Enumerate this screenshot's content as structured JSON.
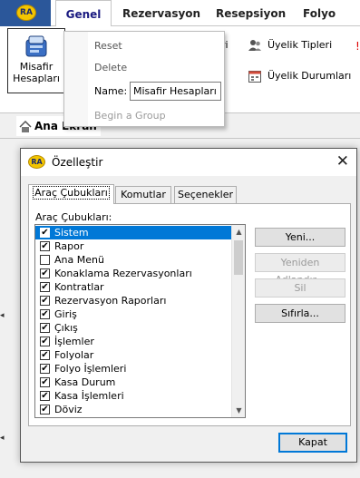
{
  "ribbon": {
    "app_logo": "RA",
    "tabs": [
      "Genel",
      "Rezervasyon",
      "Resepsiyon",
      "Folyo"
    ],
    "active_tab": "Genel",
    "misafir_button": {
      "line1": "Misafir",
      "line2": "Hesapları"
    },
    "partial_text": "ri",
    "right_items": [
      "Üyelik Tipleri",
      "Üyelik Durumları"
    ]
  },
  "context_menu": {
    "reset": "Reset",
    "delete": "Delete",
    "name_label": "Name:",
    "name_value": "Misafir Hesapları",
    "begin_group": "Begin a Group"
  },
  "document_tab": {
    "label": "Ana Ekran"
  },
  "dialog": {
    "logo": "RA",
    "title": "Özelleştir",
    "close": "✕",
    "tabs": [
      "Araç Çubukları",
      "Komutlar",
      "Seçenekler"
    ],
    "list_label": "Araç Çubukları:",
    "toolbars": [
      {
        "label": "Sistem",
        "checked": true,
        "selected": true
      },
      {
        "label": "Rapor",
        "checked": true
      },
      {
        "label": "Ana Menü",
        "checked": false
      },
      {
        "label": "Konaklama Rezervasyonları",
        "checked": true
      },
      {
        "label": "Kontratlar",
        "checked": true
      },
      {
        "label": "Rezervasyon Raporları",
        "checked": true
      },
      {
        "label": "Giriş",
        "checked": true
      },
      {
        "label": "Çıkış",
        "checked": true
      },
      {
        "label": "İşlemler",
        "checked": true
      },
      {
        "label": "Folyolar",
        "checked": true
      },
      {
        "label": "Folyo İşlemleri",
        "checked": true
      },
      {
        "label": "Kasa Durum",
        "checked": true
      },
      {
        "label": "Kasa İşlemleri",
        "checked": true
      },
      {
        "label": "Döviz",
        "checked": true
      }
    ],
    "buttons": {
      "new": "Yeni...",
      "rename": "Yeniden Adlandır...",
      "delete": "Sil",
      "reset": "Sıfırla..."
    },
    "close_button": "Kapat"
  },
  "colors": {
    "selection": "#0078d7",
    "app_blue": "#2b579a",
    "logo_yellow": "#f3c500"
  }
}
